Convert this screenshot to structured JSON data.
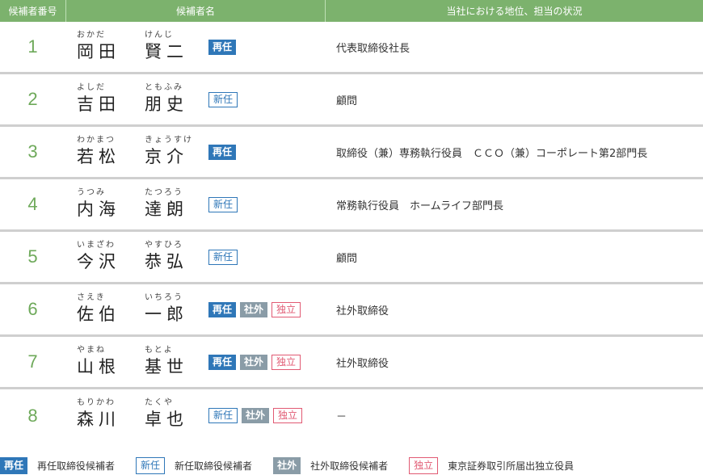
{
  "header": {
    "col_no": "候補者番号",
    "col_name": "候補者名",
    "col_pos": "当社における地位、担当の状況"
  },
  "badge_labels": {
    "sai": "再任",
    "shin": "新任",
    "sha": "社外",
    "doku": "独立"
  },
  "rows": [
    {
      "no": "1",
      "last_ruby": "おかだ",
      "last": "岡田",
      "first_ruby": "けんじ",
      "first": "賢二",
      "badges": [
        "sai"
      ],
      "position": "代表取締役社長"
    },
    {
      "no": "2",
      "last_ruby": "よしだ",
      "last": "吉田",
      "first_ruby": "ともふみ",
      "first": "朋史",
      "badges": [
        "shin"
      ],
      "position": "顧問"
    },
    {
      "no": "3",
      "last_ruby": "わかまつ",
      "last": "若松",
      "first_ruby": "きょうすけ",
      "first": "京介",
      "badges": [
        "sai"
      ],
      "position": "取締役（兼）専務執行役員　ＣＣＯ（兼）コーポレート第2部門長"
    },
    {
      "no": "4",
      "last_ruby": "うつみ",
      "last": "内海",
      "first_ruby": "たつろう",
      "first": "達朗",
      "badges": [
        "shin"
      ],
      "position": "常務執行役員　ホームライフ部門長"
    },
    {
      "no": "5",
      "last_ruby": "いまざわ",
      "last": "今沢",
      "first_ruby": "やすひろ",
      "first": "恭弘",
      "badges": [
        "shin"
      ],
      "position": "顧問"
    },
    {
      "no": "6",
      "last_ruby": "さえき",
      "last": "佐伯",
      "first_ruby": "いちろう",
      "first": "一郎",
      "badges": [
        "sai",
        "sha",
        "doku"
      ],
      "position": "社外取締役"
    },
    {
      "no": "7",
      "last_ruby": "やまね",
      "last": "山根",
      "first_ruby": "もとよ",
      "first": "基世",
      "badges": [
        "sai",
        "sha",
        "doku"
      ],
      "position": "社外取締役"
    },
    {
      "no": "8",
      "last_ruby": "もりかわ",
      "last": "森川",
      "first_ruby": "たくや",
      "first": "卓也",
      "badges": [
        "shin",
        "sha",
        "doku"
      ],
      "position": "－"
    }
  ],
  "legend": [
    {
      "badge": "sai",
      "label": "再任",
      "text": "再任取締役候補者"
    },
    {
      "badge": "shin",
      "label": "新任",
      "text": "新任取締役候補者"
    },
    {
      "badge": "sha",
      "label": "社外",
      "text": "社外取締役候補者"
    },
    {
      "badge": "doku",
      "label": "独立",
      "text": "東京証券取引所届出独立役員"
    }
  ],
  "colors": {
    "header_bg": "#7cb26d",
    "number": "#6ea95a",
    "sai": "#2f77b8",
    "sha": "#8a9ca7",
    "doku": "#e15a73"
  }
}
